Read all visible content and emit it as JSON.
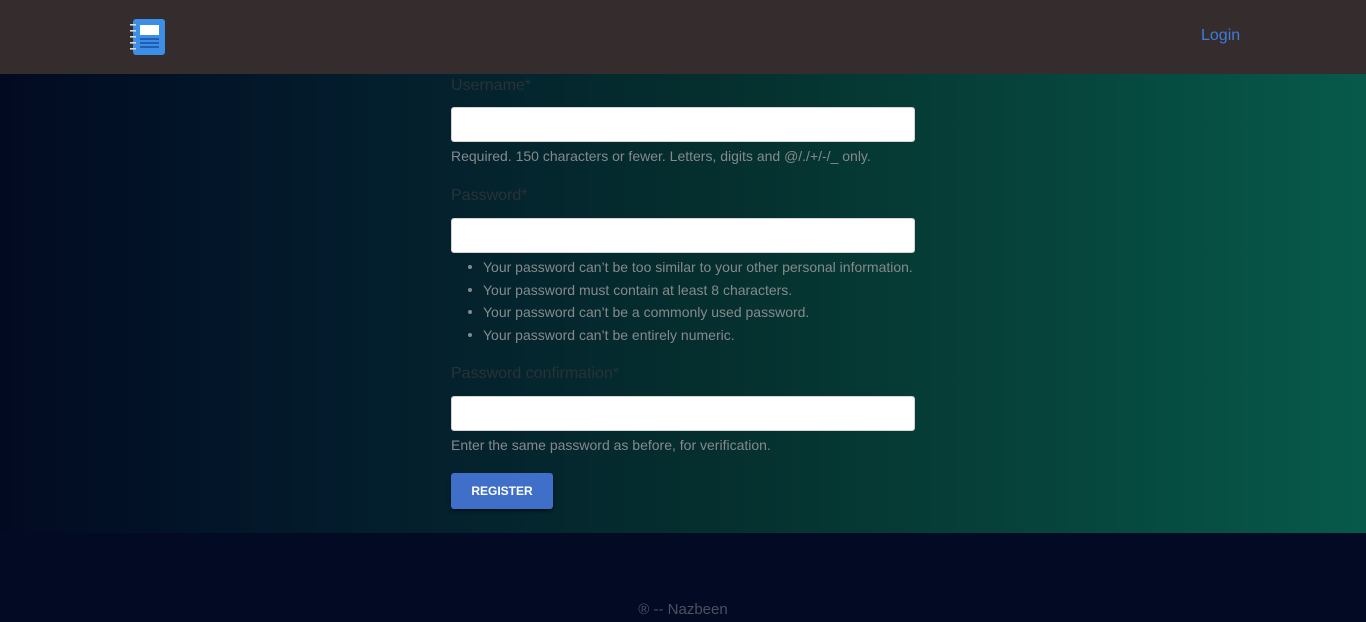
{
  "navbar": {
    "brand_icon": "notebook-icon",
    "login_label": "Login"
  },
  "form": {
    "username": {
      "label": "Username*",
      "value": "",
      "help": "Required. 150 characters or fewer. Letters, digits and @/./+/-/_ only."
    },
    "password": {
      "label": "Password*",
      "value": "",
      "rules": [
        "Your password can’t be too similar to your other personal information.",
        "Your password must contain at least 8 characters.",
        "Your password can’t be a commonly used password.",
        "Your password can’t be entirely numeric."
      ]
    },
    "password_confirmation": {
      "label": "Password confirmation*",
      "value": "",
      "help": "Enter the same password as before, for verification."
    },
    "submit_label": "REGISTER"
  },
  "footer": {
    "text": "® -- Nazbeen"
  },
  "colors": {
    "navbar_bg": "#352d2d",
    "accent": "#3f6fc9",
    "link": "#3d7bdb",
    "footer_bg": "#020a24",
    "gradient_start": "#020a22",
    "gradient_end": "#075a4a"
  }
}
